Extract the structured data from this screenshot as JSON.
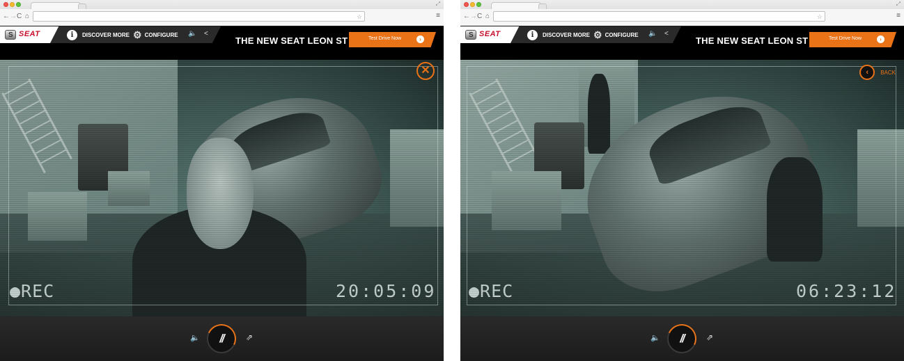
{
  "brand": {
    "logo_text": "SEAT",
    "badge_glyph": "S"
  },
  "nav": {
    "discover": "DISCOVER MORE",
    "configure": "CONFIGURE",
    "info_icon_glyph": "i",
    "gear_icon_glyph": "⚙",
    "sound_icon_glyph": "🔈",
    "share_icon_glyph": "<"
  },
  "headline": "THE NEW SEAT LEON ST",
  "cta": {
    "label": "Test Drive Now",
    "arrow_glyph": "›"
  },
  "overlay": {
    "rec_label": "●REC"
  },
  "left": {
    "timecode": "20:05:09",
    "close_glyph": "✕"
  },
  "right": {
    "timecode": "06:23:12",
    "back_label": "BACK",
    "back_glyph": "‹"
  },
  "controls": {
    "volume_glyph": "🔈",
    "pause_glyph": "//",
    "share_glyph": "⇗",
    "playback_progress": 0.3
  },
  "chrome": {
    "back_glyph": "←",
    "forward_glyph": "→",
    "reload_glyph": "C",
    "home_glyph": "⌂",
    "star_glyph": "☆",
    "menu_glyph": "≡",
    "expand_glyph": "⤢"
  },
  "colors": {
    "accent": "#ea7217",
    "header_bg": "#000000",
    "brand_red": "#c8102e"
  }
}
